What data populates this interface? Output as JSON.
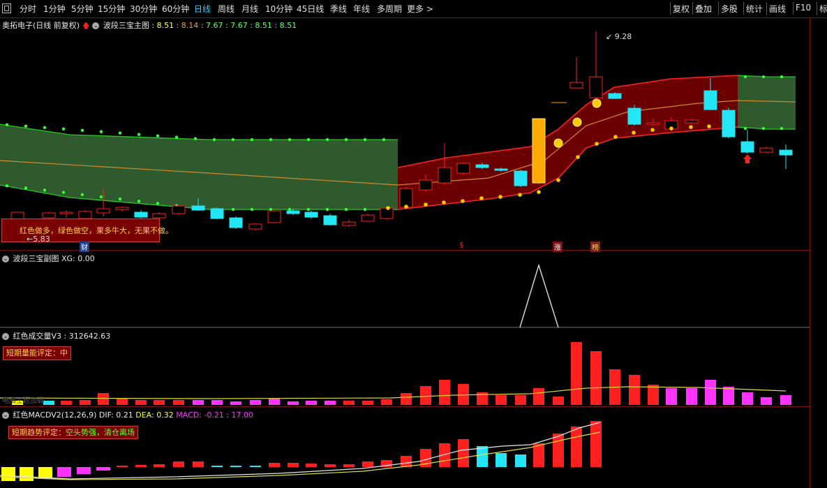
{
  "toolbar": {
    "left_items": [
      "分时",
      "1分钟",
      "5分钟",
      "15分钟",
      "30分钟",
      "60分钟",
      "日线",
      "周线",
      "月线",
      "10分钟",
      "45日线",
      "季线",
      "年线",
      "多周期",
      "更多 >"
    ],
    "active": "日线",
    "right_items": [
      "复权",
      "叠加",
      "多股",
      "统计",
      "画线",
      "F10",
      "标"
    ]
  },
  "main": {
    "title": "奥拓电子(日线 前复权)",
    "indicator": "波段三宝主图",
    "values": [
      ": 8.51",
      ": 8.14",
      ": 7.67",
      ": 7.67",
      ": 8.51",
      ": 8.51"
    ],
    "value_colors": [
      "#ffff66",
      "#ff9933",
      "#66ff66",
      "#66ff66",
      "#66ff66",
      "#66ff66"
    ],
    "high_label": "9.28",
    "low_label": "5.83",
    "note": "红色做多，绿色做空，果多牛大，无果不做。",
    "events": {
      "cai": "财",
      "s": "§",
      "zhang": "涨",
      "bang": "榜"
    }
  },
  "sub1": {
    "title": "波段三宝副图",
    "value": "XG: 0.00"
  },
  "sub2": {
    "title": "红色成交量V3",
    "value": ": 312642.63",
    "badge_label": "短期量能评定：",
    "badge_value": "中",
    "faint_text": "电脑主题加载"
  },
  "sub3": {
    "title": "红色MACDV2(12,26,9)",
    "dif": "DIF: 0.21",
    "dea": "DEA: 0.32",
    "macd": "MACD: -0.21 : 17.00",
    "badge_label": "短期趋势评定：",
    "badge_value": "空头势强，清仓离场"
  },
  "colors": {
    "up": "#ff2020",
    "down": "#22e5f5",
    "band_red": "#6a0000",
    "band_green": "#2e5a2e",
    "accent": "#33ccff"
  }
}
